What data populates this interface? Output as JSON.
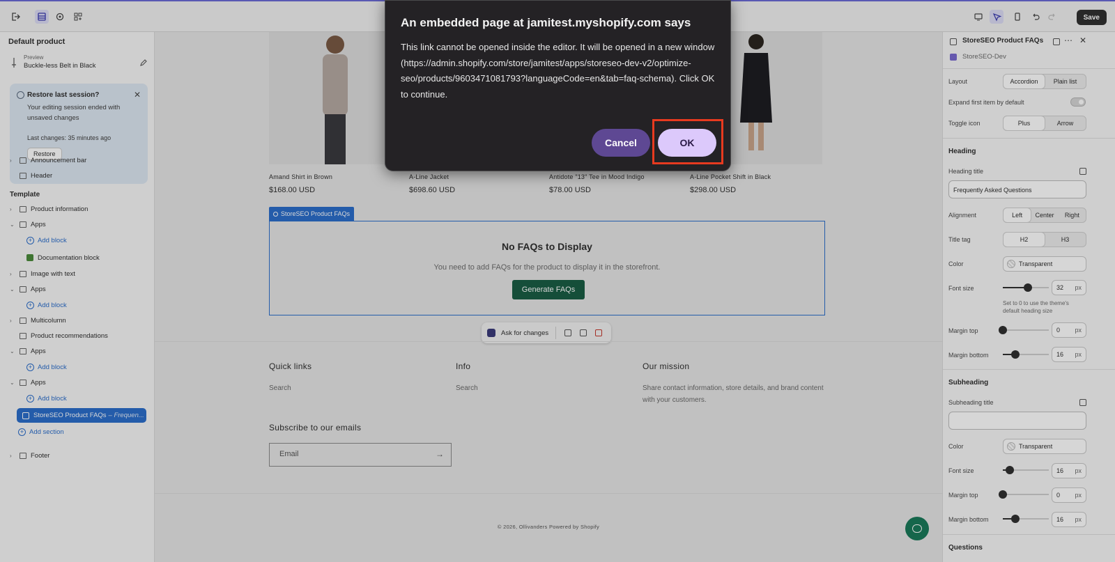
{
  "topbar": {
    "save_label": "Save"
  },
  "left": {
    "title": "Default product",
    "preview_label": "Preview",
    "preview_name": "Buckle-less Belt in Black",
    "restore": {
      "title": "Restore last session?",
      "body": "Your editing session ended with unsaved changes",
      "last_changes": "Last changes: 35 minutes ago",
      "button": "Restore"
    },
    "items": {
      "announcement": "Announcement bar",
      "header": "Header",
      "template": "Template",
      "product_information": "Product information",
      "apps1": "Apps",
      "add_block1": "Add block",
      "documentation": "Documentation block",
      "image_with_text": "Image with text",
      "apps2": "Apps",
      "add_block2": "Add block",
      "multicolumn": "Multicolumn",
      "product_recs": "Product recommendations",
      "apps3": "Apps",
      "add_block3": "Add block",
      "apps4": "Apps",
      "add_block4": "Add block",
      "storeseo": "StoreSEO Product FAQs",
      "storeseo_suffix": "– Frequen...",
      "add_section": "Add section",
      "footer": "Footer"
    }
  },
  "center": {
    "products": [
      {
        "name": "Amand Shirt in Brown",
        "price": "$168.00 USD"
      },
      {
        "name": "A-Line Jacket",
        "price": "$698.60 USD"
      },
      {
        "name": "Antidote \"13\" Tee in Mood Indigo",
        "price": "$78.00 USD"
      },
      {
        "name": "A-Line Pocket Shift in Black",
        "price": "$298.00 USD"
      }
    ],
    "faq_tag": "StoreSEO Product FAQs",
    "faq_title": "No FAQs to Display",
    "faq_sub": "You need to add FAQs for the product to display it in the storefront.",
    "faq_button": "Generate FAQs",
    "ask_label": "Ask for changes",
    "footer": {
      "quick_links": "Quick links",
      "quick_search": "Search",
      "info": "Info",
      "info_search": "Search",
      "mission": "Our mission",
      "mission_text": "Share contact information, store details, and brand content with your customers.",
      "subscribe": "Subscribe to our emails",
      "email_placeholder": "Email",
      "copyright": "© 2026, Ollivanders Powered by Shopify"
    }
  },
  "right": {
    "title": "StoreSEO Product FAQs",
    "subtitle": "StoreSEO-Dev",
    "layout_label": "Layout",
    "layout_options": [
      "Accordion",
      "Plain list"
    ],
    "expand_label": "Expand first item by default",
    "toggle_icon_label": "Toggle icon",
    "toggle_icon_options": [
      "Plus",
      "Arrow"
    ],
    "heading": "Heading",
    "heading_title_label": "Heading title",
    "heading_title_value": "Frequently Asked Questions",
    "alignment_label": "Alignment",
    "alignment_options": [
      "Left",
      "Center",
      "Right"
    ],
    "title_tag_label": "Title tag",
    "title_tag_options": [
      "H2",
      "H3"
    ],
    "color_label": "Color",
    "color_value": "Transparent",
    "font_size_label": "Font size",
    "font_size_value": "32",
    "px": "px",
    "font_hint": "Set to 0 to use the theme's default heading size",
    "margin_top_label": "Margin top",
    "margin_top_value": "0",
    "margin_bottom_label": "Margin bottom",
    "margin_bottom_value": "16",
    "subheading": "Subheading",
    "subheading_title_label": "Subheading title",
    "sub_color_label": "Color",
    "sub_color_value": "Transparent",
    "sub_font_size_label": "Font size",
    "sub_font_size_value": "16",
    "sub_margin_top_label": "Margin top",
    "sub_margin_top_value": "0",
    "sub_margin_bottom_label": "Margin bottom",
    "sub_margin_bottom_value": "16",
    "questions": "Questions",
    "heading_font_size_level": 0.55,
    "heading_margin_bottom_level": 0.27,
    "sub_font_size_level": 0.15,
    "sub_margin_bottom_level": 0.27
  },
  "dialog": {
    "title": "An embedded page at jamitest.myshopify.com says",
    "body": "This link cannot be opened inside the editor. It will be opened in a new window (https://admin.shopify.com/store/jamitest/apps/storeseo-dev-v2/optimize-seo/products/9603471081793?languageCode=en&tab=faq-schema). Click OK to continue.",
    "cancel": "Cancel",
    "ok": "OK"
  },
  "colors": {
    "accent": "#2c6ecb",
    "ok_bg": "#dcc9fb",
    "cancel_bg": "#5e4893",
    "highlight": "#e83a1f",
    "generate_btn": "#1a5e44"
  }
}
